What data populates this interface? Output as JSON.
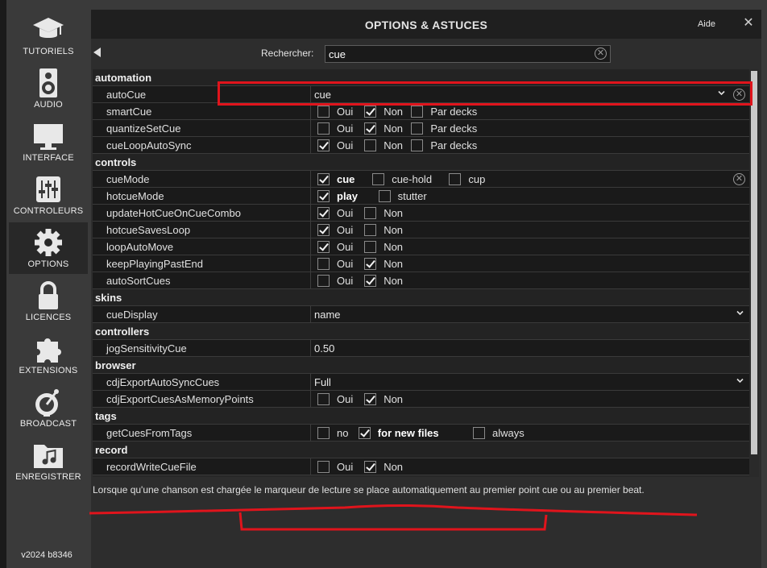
{
  "sidebar": {
    "items": [
      {
        "label": "TUTORIELS",
        "icon": "graduation-cap-icon"
      },
      {
        "label": "AUDIO",
        "icon": "speaker-icon"
      },
      {
        "label": "INTERFACE",
        "icon": "monitor-icon"
      },
      {
        "label": "CONTROLEURS",
        "icon": "sliders-icon"
      },
      {
        "label": "OPTIONS",
        "icon": "gear-icon",
        "active": true
      },
      {
        "label": "LICENCES",
        "icon": "lock-icon"
      },
      {
        "label": "EXTENSIONS",
        "icon": "puzzle-icon"
      },
      {
        "label": "BROADCAST",
        "icon": "satellite-dish-icon"
      },
      {
        "label": "ENREGISTRER",
        "icon": "music-folder-icon"
      }
    ],
    "version": "v2024 b8346"
  },
  "header": {
    "title": "OPTIONS & ASTUCES",
    "help": "Aide",
    "close": "✕"
  },
  "search": {
    "label": "Rechercher:",
    "value": "cue"
  },
  "settings": [
    {
      "category": "automation",
      "rows": [
        {
          "name": "autoCue",
          "value": "cue",
          "dropdown": true,
          "clear": true
        },
        {
          "name": "smartCue",
          "options": [
            {
              "t": "Oui",
              "c": false
            },
            {
              "t": "Non",
              "c": true
            },
            {
              "t": "Par decks",
              "c": false
            }
          ]
        },
        {
          "name": "quantizeSetCue",
          "options": [
            {
              "t": "Oui",
              "c": false
            },
            {
              "t": "Non",
              "c": true
            },
            {
              "t": "Par decks",
              "c": false
            }
          ]
        },
        {
          "name": "cueLoopAutoSync",
          "options": [
            {
              "t": "Oui",
              "c": true
            },
            {
              "t": "Non",
              "c": false
            },
            {
              "t": "Par decks",
              "c": false
            }
          ]
        }
      ]
    },
    {
      "category": "controls",
      "rows": [
        {
          "name": "cueMode",
          "options": [
            {
              "t": "cue",
              "c": true,
              "b": true
            },
            {
              "t": "cue-hold",
              "c": false
            },
            {
              "t": "cup",
              "c": false
            }
          ],
          "clear": true
        },
        {
          "name": "hotcueMode",
          "options": [
            {
              "t": "play",
              "c": true,
              "b": true
            },
            {
              "t": "stutter",
              "c": false
            }
          ]
        },
        {
          "name": "updateHotCueOnCueCombo",
          "options": [
            {
              "t": "Oui",
              "c": true
            },
            {
              "t": "Non",
              "c": false
            }
          ]
        },
        {
          "name": "hotcueSavesLoop",
          "options": [
            {
              "t": "Oui",
              "c": true
            },
            {
              "t": "Non",
              "c": false
            }
          ]
        },
        {
          "name": "loopAutoMove",
          "options": [
            {
              "t": "Oui",
              "c": true
            },
            {
              "t": "Non",
              "c": false
            }
          ]
        },
        {
          "name": "keepPlayingPastEnd",
          "options": [
            {
              "t": "Oui",
              "c": false
            },
            {
              "t": "Non",
              "c": true
            }
          ]
        },
        {
          "name": "autoSortCues",
          "options": [
            {
              "t": "Oui",
              "c": false
            },
            {
              "t": "Non",
              "c": true
            }
          ]
        }
      ]
    },
    {
      "category": "skins",
      "rows": [
        {
          "name": "cueDisplay",
          "value": "name",
          "dropdown": true
        }
      ]
    },
    {
      "category": "controllers",
      "rows": [
        {
          "name": "jogSensitivityCue",
          "value": "0.50"
        }
      ]
    },
    {
      "category": "browser",
      "rows": [
        {
          "name": "cdjExportAutoSyncCues",
          "value": "Full",
          "dropdown": true
        },
        {
          "name": "cdjExportCuesAsMemoryPoints",
          "options": [
            {
              "t": "Oui",
              "c": false
            },
            {
              "t": "Non",
              "c": true
            }
          ]
        }
      ]
    },
    {
      "category": "tags",
      "rows": [
        {
          "name": "getCuesFromTags",
          "options": [
            {
              "t": "no",
              "c": false
            },
            {
              "t": "for new files",
              "c": true,
              "b": true
            },
            {
              "t": "always",
              "c": false
            }
          ]
        }
      ]
    },
    {
      "category": "record",
      "rows": [
        {
          "name": "recordWriteCueFile",
          "options": [
            {
              "t": "Oui",
              "c": false
            },
            {
              "t": "Non",
              "c": true
            }
          ]
        }
      ]
    }
  ],
  "description": "Lorsque qu'une chanson est chargée le marqueur de lecture se place automatiquement au premier point cue ou au premier beat.",
  "annotation_color": "#e0141c"
}
